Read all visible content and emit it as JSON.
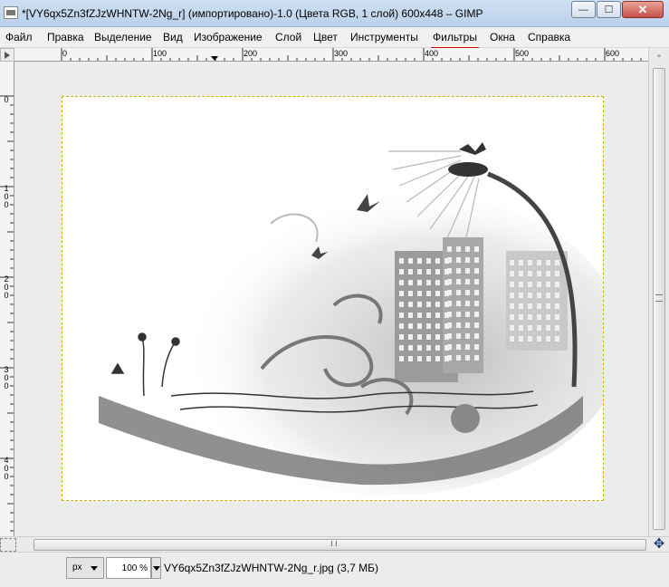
{
  "window": {
    "title": "*[VY6qx5Zn3fZJzWHNTW-2Ng_r] (импортировано)-1.0 (Цвета RGB, 1 слой) 600x448 – GIMP",
    "min_glyph": "—",
    "max_glyph": "☐",
    "close_glyph": "✕"
  },
  "menu": {
    "items": [
      {
        "label": "Файл"
      },
      {
        "label": "Правка"
      },
      {
        "label": "Выделение"
      },
      {
        "label": "Вид"
      },
      {
        "label": "Изображение"
      },
      {
        "label": "Слой"
      },
      {
        "label": "Цвет"
      },
      {
        "label": "Инструменты"
      },
      {
        "label": "Фильтры"
      },
      {
        "label": "Окна"
      },
      {
        "label": "Справка"
      }
    ],
    "active": "Фильтры",
    "active_color": "#d40000"
  },
  "rulers": {
    "horizontal": [
      "0",
      "100",
      "200",
      "300",
      "400",
      "500",
      "600"
    ],
    "vertical": [
      "0",
      "100",
      "200",
      "300",
      "400"
    ]
  },
  "image": {
    "description_icon": "grunge-city-illustration",
    "selection_color": "#c9b400"
  },
  "status": {
    "unit": "px",
    "zoom": "100 %",
    "file_info": "VY6qx5Zn3fZJzWHNTW-2Ng_r.jpg (3,7 МБ)"
  },
  "icons": {
    "navigate": "✥"
  }
}
